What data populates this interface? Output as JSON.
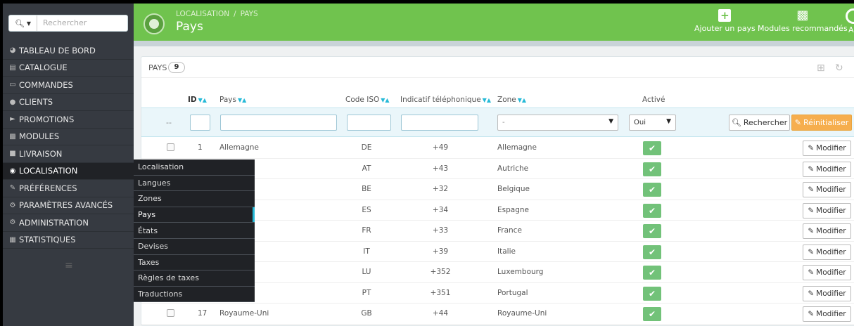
{
  "search": {
    "button_icon": "search-icon",
    "placeholder": "Rechercher"
  },
  "nav": {
    "items": [
      {
        "label": "TABLEAU DE BORD",
        "icon": "dashboard-icon"
      },
      {
        "label": "CATALOGUE",
        "icon": "book-icon"
      },
      {
        "label": "COMMANDES",
        "icon": "credit-card-icon"
      },
      {
        "label": "CLIENTS",
        "icon": "users-icon"
      },
      {
        "label": "PROMOTIONS",
        "icon": "tag-icon"
      },
      {
        "label": "MODULES",
        "icon": "puzzle-icon"
      },
      {
        "label": "LIVRAISON",
        "icon": "truck-icon"
      },
      {
        "label": "LOCALISATION",
        "icon": "globe-icon",
        "active": true
      },
      {
        "label": "PRÉFÉRENCES",
        "icon": "wrench-icon"
      },
      {
        "label": "PARAMÈTRES AVANCÉS",
        "icon": "cogs-icon"
      },
      {
        "label": "ADMINISTRATION",
        "icon": "cog-icon"
      },
      {
        "label": "STATISTIQUES",
        "icon": "chart-icon"
      }
    ]
  },
  "submenu": {
    "items": [
      "Localisation",
      "Langues",
      "Zones",
      "Pays",
      "États",
      "Devises",
      "Taxes",
      "Règles de taxes",
      "Traductions"
    ],
    "active": "Pays"
  },
  "header": {
    "breadcrumb": [
      "LOCALISATION",
      "/",
      "PAYS"
    ],
    "title": "Pays",
    "toolbar": {
      "add_label": "Ajouter un pays",
      "modules_label": "Modules recommandés",
      "help_label": "Ai"
    }
  },
  "panel": {
    "title": "PAYS",
    "count": "9",
    "columns": {
      "id": "ID",
      "name": "Pays",
      "iso": "Code ISO",
      "phone": "Indicatif téléphonique",
      "zone": "Zone",
      "active": "Activé"
    },
    "filters": {
      "dash": "--",
      "zone_value": "-",
      "active_value": "Oui",
      "search_label": "Rechercher",
      "reset_label": "Réinitialiser"
    },
    "edit_label": "Modifier",
    "rows": [
      {
        "id": "1",
        "name": "Allemagne",
        "iso": "DE",
        "phone": "+49",
        "zone": "Allemagne"
      },
      {
        "id": "",
        "name": "",
        "iso": "AT",
        "phone": "+43",
        "zone": "Autriche"
      },
      {
        "id": "",
        "name": "",
        "iso": "BE",
        "phone": "+32",
        "zone": "Belgique"
      },
      {
        "id": "",
        "name": "",
        "iso": "ES",
        "phone": "+34",
        "zone": "Espagne"
      },
      {
        "id": "",
        "name": "",
        "iso": "FR",
        "phone": "+33",
        "zone": "France"
      },
      {
        "id": "",
        "name": "",
        "iso": "IT",
        "phone": "+39",
        "zone": "Italie"
      },
      {
        "id": "",
        "name": "g",
        "iso": "LU",
        "phone": "+352",
        "zone": "Luxembourg"
      },
      {
        "id": "",
        "name": "",
        "iso": "PT",
        "phone": "+351",
        "zone": "Portugal"
      },
      {
        "id": "17",
        "name": "Royaume-Uni",
        "iso": "GB",
        "phone": "+44",
        "zone": "Royaume-Uni"
      }
    ]
  },
  "colors": {
    "header_green": "#70c34e",
    "sidebar": "#363a41",
    "accent_blue": "#25b9d7",
    "reset_orange": "#f6ae4e",
    "active_green": "#72c279"
  }
}
